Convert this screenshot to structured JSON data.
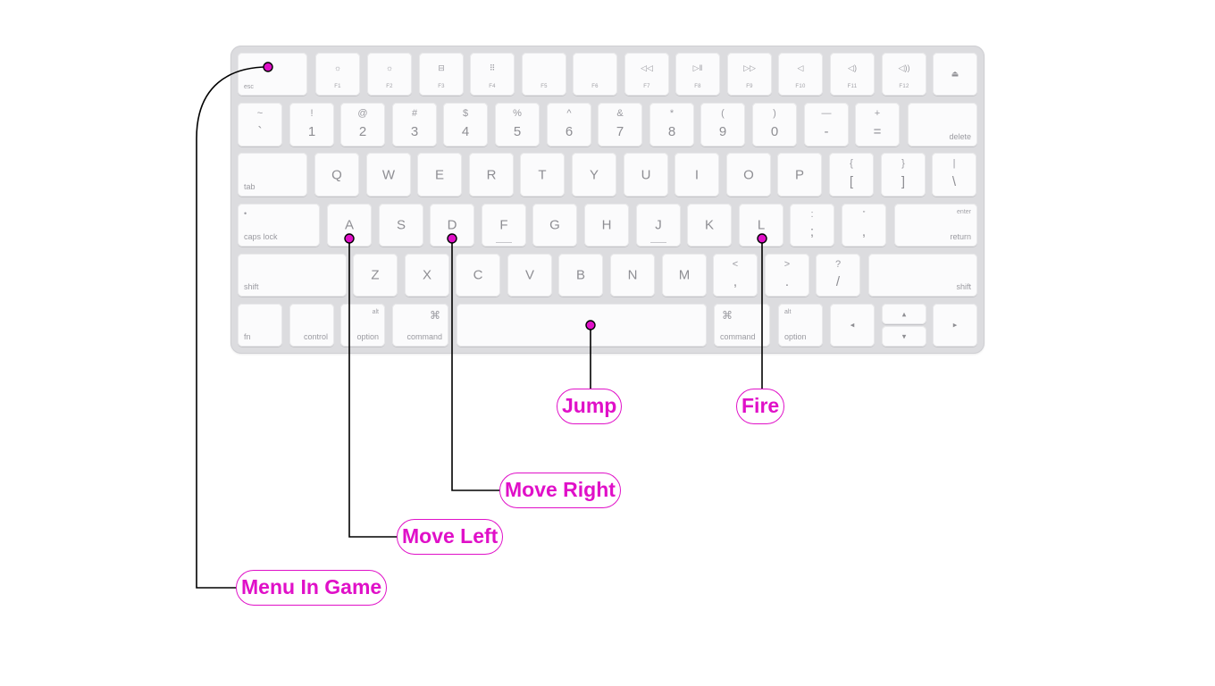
{
  "keyboard": {
    "esc": "esc",
    "fkeys": [
      "F1",
      "F2",
      "F3",
      "F4",
      "F5",
      "F6",
      "F7",
      "F8",
      "F9",
      "F10",
      "F11",
      "F12"
    ],
    "fkey_icons": [
      "☼",
      "☼",
      "⊟",
      "⠿",
      "",
      "",
      "◁◁",
      "▷ǁ",
      "▷▷",
      "◁",
      "◁)",
      "◁))"
    ],
    "eject": "⏏",
    "number_row": [
      {
        "top": "~",
        "bottom": "`"
      },
      {
        "top": "!",
        "bottom": "1"
      },
      {
        "top": "@",
        "bottom": "2"
      },
      {
        "top": "#",
        "bottom": "3"
      },
      {
        "top": "$",
        "bottom": "4"
      },
      {
        "top": "%",
        "bottom": "5"
      },
      {
        "top": "^",
        "bottom": "6"
      },
      {
        "top": "&",
        "bottom": "7"
      },
      {
        "top": "*",
        "bottom": "8"
      },
      {
        "top": "(",
        "bottom": "9"
      },
      {
        "top": ")",
        "bottom": "0"
      },
      {
        "top": "—",
        "bottom": "-"
      },
      {
        "top": "+",
        "bottom": "="
      }
    ],
    "delete": "delete",
    "tab": "tab",
    "qwerty_row": [
      "Q",
      "W",
      "E",
      "R",
      "T",
      "Y",
      "U",
      "I",
      "O",
      "P"
    ],
    "bracket_keys": [
      {
        "top": "{",
        "bottom": "["
      },
      {
        "top": "}",
        "bottom": "]"
      },
      {
        "top": "|",
        "bottom": "\\"
      }
    ],
    "caps_lock": "caps lock",
    "caps_dot": "•",
    "home_row": [
      "A",
      "S",
      "D",
      "F",
      "G",
      "H",
      "J",
      "K",
      "L"
    ],
    "semicolon": {
      "top": ":",
      "bottom": ";"
    },
    "quote": {
      "top": "\"",
      "bottom": ","
    },
    "enter": "enter",
    "return": "return",
    "shift": "shift",
    "bottom_letters": [
      "Z",
      "X",
      "C",
      "V",
      "B",
      "N",
      "M"
    ],
    "punct_keys": [
      {
        "top": "<",
        "bottom": ","
      },
      {
        "top": ">",
        "bottom": "."
      },
      {
        "top": "?",
        "bottom": "/"
      }
    ],
    "fn": "fn",
    "control": "control",
    "alt": "alt",
    "option": "option",
    "command": "command",
    "cmd_symbol": "⌘",
    "arrow_left": "◂",
    "arrow_right": "▸",
    "arrow_up": "▴",
    "arrow_down": "▾"
  },
  "callouts": {
    "jump": "Jump",
    "fire": "Fire",
    "move_right": "Move Right",
    "move_left": "Move Left",
    "menu": "Menu In Game"
  },
  "colors": {
    "accent": "#e010c8",
    "line": "#000000",
    "keyboard_body": "#dcdcdf",
    "key_face": "#fbfbfc"
  }
}
